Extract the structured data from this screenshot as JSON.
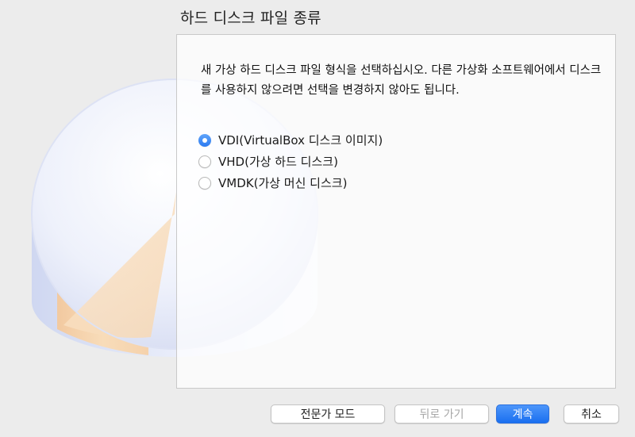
{
  "dialog": {
    "title": "하드 디스크 파일 종류",
    "description": "새 가상 하드 디스크 파일 형식을 선택하십시오. 다른 가상화 소프트웨어에서 디스크를 사용하지 않으려면 선택을 변경하지 않아도 됩니다."
  },
  "options": [
    {
      "label": "VDI(VirtualBox 디스크 이미지)",
      "selected": true
    },
    {
      "label": "VHD(가상 하드 디스크)",
      "selected": false
    },
    {
      "label": "VMDK(가상 머신 디스크)",
      "selected": false
    }
  ],
  "buttons": {
    "expert": "전문가 모드",
    "back": "뒤로 가기",
    "next": "계속",
    "cancel": "취소"
  },
  "colors": {
    "accent": "#2b7af0",
    "background": "#ececec"
  }
}
